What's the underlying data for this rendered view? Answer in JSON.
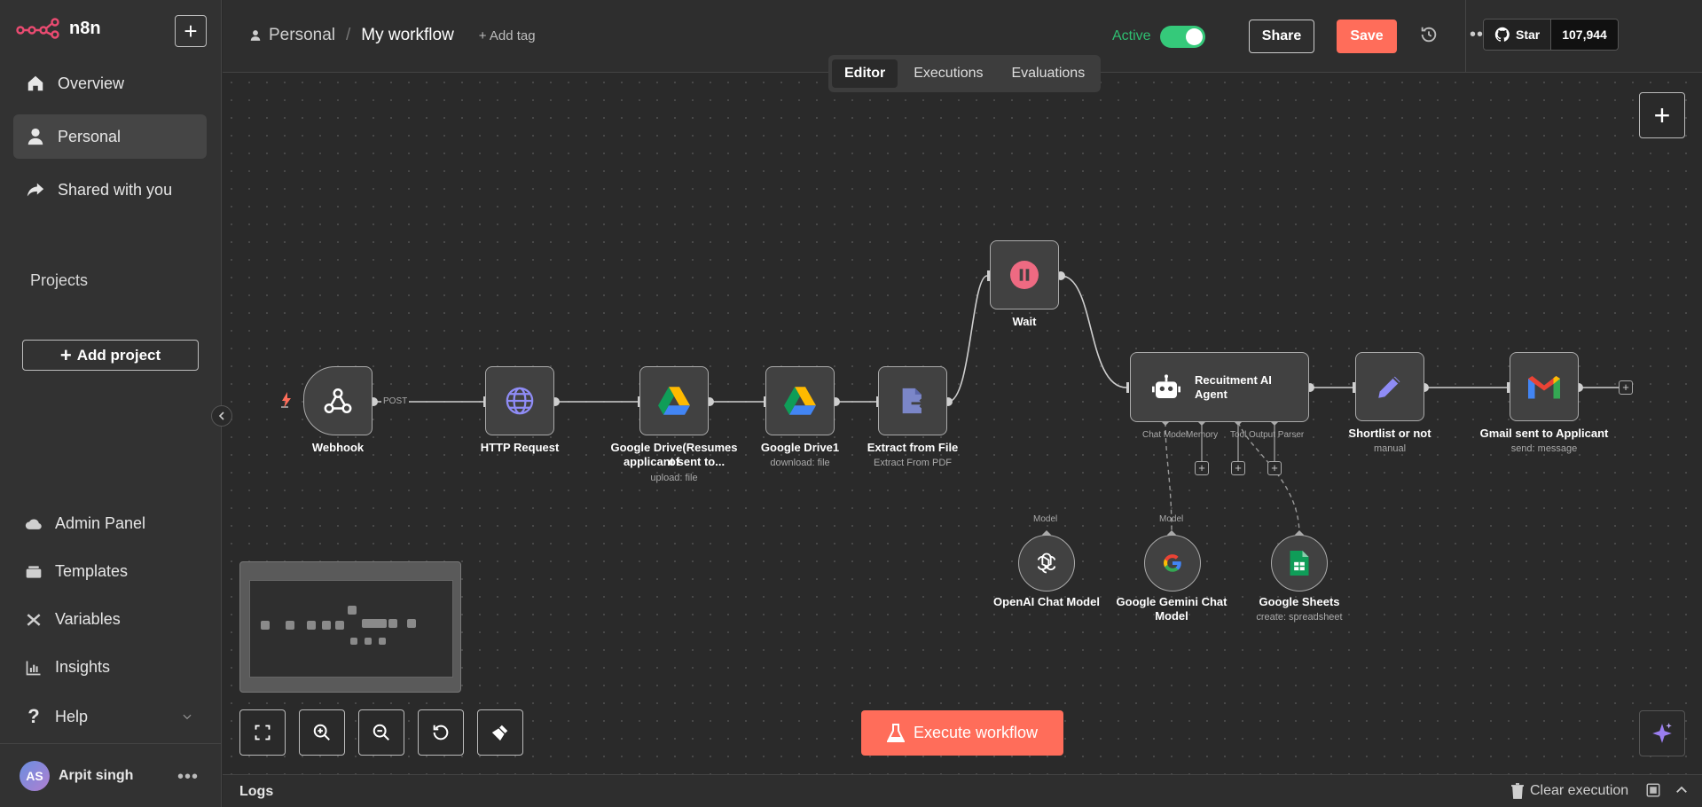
{
  "sidebar": {
    "logo": "n8n",
    "new_label": "+",
    "nav": [
      {
        "label": "Overview",
        "icon": "home-icon"
      },
      {
        "label": "Personal",
        "icon": "user-icon",
        "active": true
      },
      {
        "label": "Shared with you",
        "icon": "share-icon"
      }
    ],
    "projects_label": "Projects",
    "add_project": "Add project",
    "bottom": [
      {
        "label": "Admin Panel",
        "icon": "cloud-icon"
      },
      {
        "label": "Templates",
        "icon": "templates-icon"
      },
      {
        "label": "Variables",
        "icon": "variables-icon"
      },
      {
        "label": "Insights",
        "icon": "insights-icon"
      },
      {
        "label": "Help",
        "icon": "help-icon"
      }
    ],
    "user": {
      "initials": "AS",
      "name": "Arpit singh"
    }
  },
  "header": {
    "breadcrumb_project": "Personal",
    "breadcrumb_separator": "/",
    "workflow_name": "My workflow",
    "add_tag": "+ Add tag",
    "active_label": "Active",
    "active": true,
    "share": "Share",
    "save": "Save",
    "github_star": "Star",
    "github_count": "107,944"
  },
  "tabs": [
    {
      "label": "Editor",
      "active": true
    },
    {
      "label": "Executions"
    },
    {
      "label": "Evaluations"
    }
  ],
  "workflow": {
    "nodes": {
      "webhook": {
        "label": "Webhook",
        "port": "POST"
      },
      "http": {
        "label": "HTTP Request"
      },
      "gdrive": {
        "label_1": "Google Drive(Resumes of",
        "label_2": "applicant sent to...",
        "sub": "upload: file"
      },
      "gdrive1": {
        "label": "Google Drive1",
        "sub": "download: file"
      },
      "extract": {
        "label": "Extract from File",
        "sub": "Extract From PDF"
      },
      "wait": {
        "label": "Wait"
      },
      "agent": {
        "label_1": "Recuitment AI",
        "label_2": "Agent",
        "ports": [
          "Chat Model",
          "Memory",
          "Tool",
          "Output Parser"
        ]
      },
      "shortlist": {
        "label": "Shortlist or not",
        "sub": "manual"
      },
      "gmail": {
        "label": "Gmail sent to Applicant",
        "sub": "send: message"
      },
      "openai": {
        "label": "OpenAI Chat Model",
        "port": "Model"
      },
      "gemini": {
        "label_1": "Google Gemini Chat",
        "label_2": "Model",
        "port": "Model"
      },
      "sheets": {
        "label": "Google Sheets",
        "sub": "create: spreadsheet"
      }
    }
  },
  "execute": "Execute workflow",
  "logs": {
    "title": "Logs",
    "clear": "Clear execution"
  },
  "colors": {
    "accent": "#ff6d5a",
    "active": "#35c97a"
  }
}
